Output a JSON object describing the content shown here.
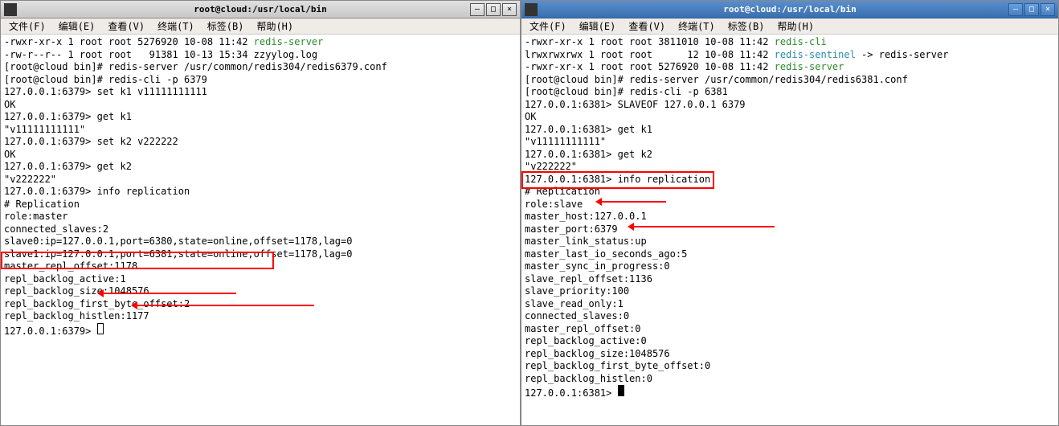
{
  "left": {
    "title": "root@cloud:/usr/local/bin",
    "menu": {
      "file": "文件(F)",
      "edit": "编辑(E)",
      "view": "查看(V)",
      "terminal": "终端(T)",
      "tabs": "标签(B)",
      "help": "帮助(H)"
    },
    "lines": [
      {
        "parts": [
          {
            "t": "-rwxr-xr-x 1 root root 5276920 10-08 11:42 "
          },
          {
            "t": "redis-server",
            "c": "cmd"
          }
        ]
      },
      {
        "parts": [
          {
            "t": "-rw-r--r-- 1 root root   91381 10-13 15:34 zzyylog.log"
          }
        ]
      },
      {
        "parts": [
          {
            "t": "[root@cloud bin]# redis-server /usr/common/redis304/redis6379.conf"
          }
        ]
      },
      {
        "parts": [
          {
            "t": "[root@cloud bin]# redis-cli -p 6379"
          }
        ]
      },
      {
        "parts": [
          {
            "t": "127.0.0.1:6379> set k1 v11111111111"
          }
        ]
      },
      {
        "parts": [
          {
            "t": "OK"
          }
        ]
      },
      {
        "parts": [
          {
            "t": "127.0.0.1:6379> get k1"
          }
        ]
      },
      {
        "parts": [
          {
            "t": "\"v11111111111\""
          }
        ]
      },
      {
        "parts": [
          {
            "t": "127.0.0.1:6379> set k2 v222222"
          }
        ]
      },
      {
        "parts": [
          {
            "t": "OK"
          }
        ]
      },
      {
        "parts": [
          {
            "t": "127.0.0.1:6379> get k2"
          }
        ]
      },
      {
        "parts": [
          {
            "t": "\"v222222\""
          }
        ]
      },
      {
        "parts": [
          {
            "t": "127.0.0.1:6379> info replication"
          }
        ]
      },
      {
        "parts": [
          {
            "t": "# Replication"
          }
        ]
      },
      {
        "parts": [
          {
            "t": "role:master"
          }
        ]
      },
      {
        "parts": [
          {
            "t": "connected_slaves:2"
          }
        ]
      },
      {
        "parts": [
          {
            "t": "slave0:ip=127.0.0.1,port=6380,state=online,offset=1178,lag=0"
          }
        ]
      },
      {
        "parts": [
          {
            "t": "slave1:ip=127.0.0.1,port=6381,state=online,offset=1178,lag=0"
          }
        ]
      },
      {
        "parts": [
          {
            "t": "master_repl_offset:1178"
          }
        ]
      },
      {
        "parts": [
          {
            "t": "repl_backlog_active:1"
          }
        ]
      },
      {
        "parts": [
          {
            "t": "repl_backlog_size:1048576"
          }
        ]
      },
      {
        "parts": [
          {
            "t": "repl_backlog_first_byte_offset:2"
          }
        ]
      },
      {
        "parts": [
          {
            "t": "repl_backlog_histlen:1177"
          }
        ]
      },
      {
        "parts": [
          {
            "t": "127.0.0.1:6379> "
          }
        ],
        "cursor": "box"
      }
    ]
  },
  "right": {
    "title": "root@cloud:/usr/local/bin",
    "menu": {
      "file": "文件(F)",
      "edit": "编辑(E)",
      "view": "查看(V)",
      "terminal": "终端(T)",
      "tabs": "标签(B)",
      "help": "帮助(H)"
    },
    "lines": [
      {
        "parts": [
          {
            "t": "-rwxr-xr-x 1 root root 3811010 10-08 11:42 "
          },
          {
            "t": "redis-cli",
            "c": "cmd"
          }
        ]
      },
      {
        "parts": [
          {
            "t": "lrwxrwxrwx 1 root root      12 10-08 11:42 "
          },
          {
            "t": "redis-sentinel",
            "c": "link"
          },
          {
            "t": " -> redis-server"
          }
        ]
      },
      {
        "parts": [
          {
            "t": "-rwxr-xr-x 1 root root 5276920 10-08 11:42 "
          },
          {
            "t": "redis-server",
            "c": "cmd"
          }
        ]
      },
      {
        "parts": [
          {
            "t": "[root@cloud bin]# redis-server /usr/common/redis304/redis6381.conf"
          }
        ]
      },
      {
        "parts": [
          {
            "t": "[root@cloud bin]# redis-cli -p 6381"
          }
        ]
      },
      {
        "parts": [
          {
            "t": "127.0.0.1:6381> SLAVEOF 127.0.0.1 6379"
          }
        ]
      },
      {
        "parts": [
          {
            "t": "OK"
          }
        ]
      },
      {
        "parts": [
          {
            "t": "127.0.0.1:6381> get k1"
          }
        ]
      },
      {
        "parts": [
          {
            "t": "\"v11111111111\""
          }
        ]
      },
      {
        "parts": [
          {
            "t": "127.0.0.1:6381> get k2"
          }
        ]
      },
      {
        "parts": [
          {
            "t": "\"v222222\""
          }
        ]
      },
      {
        "parts": [
          {
            "t": "127.0.0.1:6381> info replication"
          }
        ]
      },
      {
        "parts": [
          {
            "t": "# Replication"
          }
        ]
      },
      {
        "parts": [
          {
            "t": "role:slave"
          }
        ]
      },
      {
        "parts": [
          {
            "t": "master_host:127.0.0.1"
          }
        ]
      },
      {
        "parts": [
          {
            "t": "master_port:6379"
          }
        ]
      },
      {
        "parts": [
          {
            "t": "master_link_status:up"
          }
        ]
      },
      {
        "parts": [
          {
            "t": "master_last_io_seconds_ago:5"
          }
        ]
      },
      {
        "parts": [
          {
            "t": "master_sync_in_progress:0"
          }
        ]
      },
      {
        "parts": [
          {
            "t": "slave_repl_offset:1136"
          }
        ]
      },
      {
        "parts": [
          {
            "t": "slave_priority:100"
          }
        ]
      },
      {
        "parts": [
          {
            "t": "slave_read_only:1"
          }
        ]
      },
      {
        "parts": [
          {
            "t": "connected_slaves:0"
          }
        ]
      },
      {
        "parts": [
          {
            "t": "master_repl_offset:0"
          }
        ]
      },
      {
        "parts": [
          {
            "t": "repl_backlog_active:0"
          }
        ]
      },
      {
        "parts": [
          {
            "t": "repl_backlog_size:1048576"
          }
        ]
      },
      {
        "parts": [
          {
            "t": "repl_backlog_first_byte_offset:0"
          }
        ]
      },
      {
        "parts": [
          {
            "t": "repl_backlog_histlen:0"
          }
        ]
      },
      {
        "parts": [
          {
            "t": "127.0.0.1:6381> "
          }
        ],
        "cursor": "fill"
      }
    ]
  }
}
